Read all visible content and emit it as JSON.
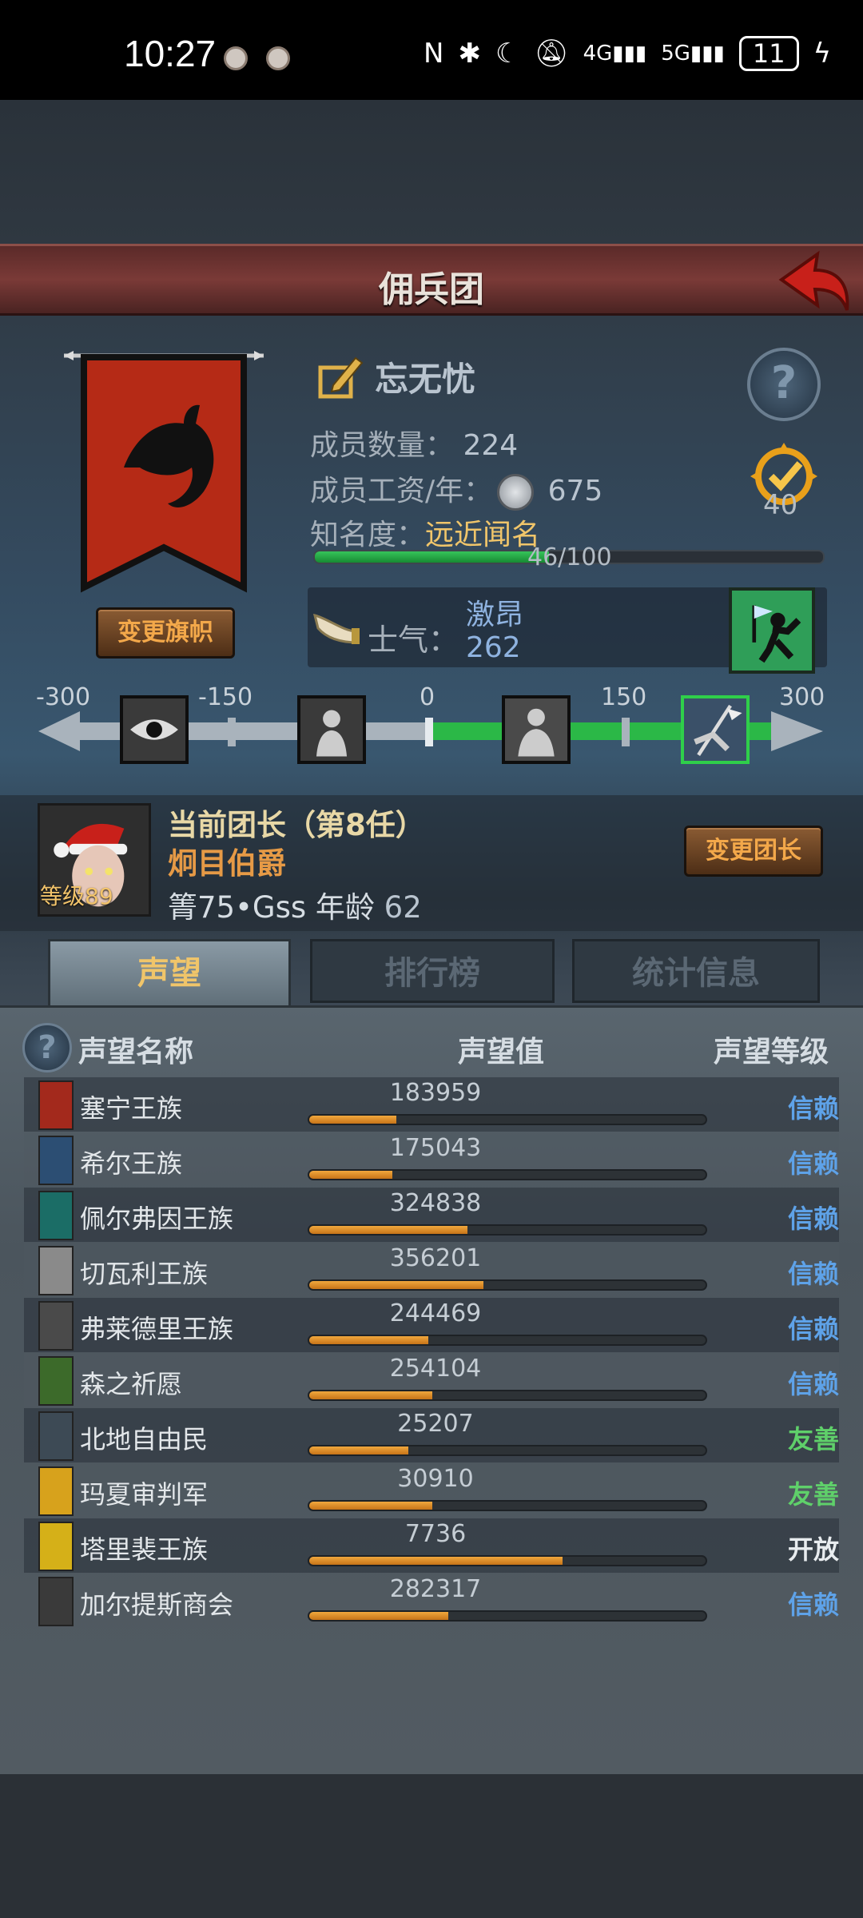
{
  "status_bar": {
    "time": "10:27",
    "battery": "11"
  },
  "header": {
    "title": "佣兵团"
  },
  "guild": {
    "name": "忘无忧",
    "members_label": "成员数量：",
    "members_value": "224",
    "salary_label": "成员工资/年：",
    "salary_value": "675",
    "fame_label": "知名度：",
    "fame_value": "远近闻名",
    "fame_progress": "46/100",
    "fame_fraction": 0.46,
    "rank_value": "40",
    "change_banner_label": "变更旗帜",
    "morale_label": "士气：",
    "morale_state": "激昂",
    "morale_value": "262"
  },
  "morale_track": {
    "ticks": [
      "-300",
      "-150",
      "0",
      "150",
      "300"
    ],
    "current": 262
  },
  "leader": {
    "title": "当前团长（第8任）",
    "name": "炯目伯爵",
    "level": "等级89",
    "info_prefix": "箐75•Gss",
    "age_label": "年龄",
    "age_value": "62",
    "change_leader_label": "变更团长"
  },
  "tabs": [
    "声望",
    "排行榜",
    "统计信息"
  ],
  "reputation": {
    "headers": {
      "name": "声望名称",
      "value": "声望值",
      "level": "声望等级"
    },
    "rows": [
      {
        "name": "塞宁王族",
        "value": "183959",
        "fill": 0.22,
        "level": "信赖",
        "level_type": "trust",
        "color": "#a3291c"
      },
      {
        "name": "希尔王族",
        "value": "175043",
        "fill": 0.21,
        "level": "信赖",
        "level_type": "trust",
        "color": "#2c4e73"
      },
      {
        "name": "佩尔弗因王族",
        "value": "324838",
        "fill": 0.4,
        "level": "信赖",
        "level_type": "trust",
        "color": "#1b6d66"
      },
      {
        "name": "切瓦利王族",
        "value": "356201",
        "fill": 0.44,
        "level": "信赖",
        "level_type": "trust",
        "color": "#8a8a8a"
      },
      {
        "name": "弗莱德里王族",
        "value": "244469",
        "fill": 0.3,
        "level": "信赖",
        "level_type": "trust",
        "color": "#4a4a4a"
      },
      {
        "name": "森之祈愿",
        "value": "254104",
        "fill": 0.31,
        "level": "信赖",
        "level_type": "trust",
        "color": "#3c6a2a"
      },
      {
        "name": "北地自由民",
        "value": "25207",
        "fill": 0.25,
        "level": "友善",
        "level_type": "friendly",
        "color": "#3d4a55"
      },
      {
        "name": "玛夏审判军",
        "value": "30910",
        "fill": 0.31,
        "level": "友善",
        "level_type": "friendly",
        "color": "#d7a21c"
      },
      {
        "name": "塔里裴王族",
        "value": "7736",
        "fill": 0.64,
        "level": "开放",
        "level_type": "open",
        "color": "#d5b018"
      },
      {
        "name": "加尔提斯商会",
        "value": "282317",
        "fill": 0.35,
        "level": "信赖",
        "level_type": "trust",
        "color": "#3a3a3a"
      }
    ]
  }
}
